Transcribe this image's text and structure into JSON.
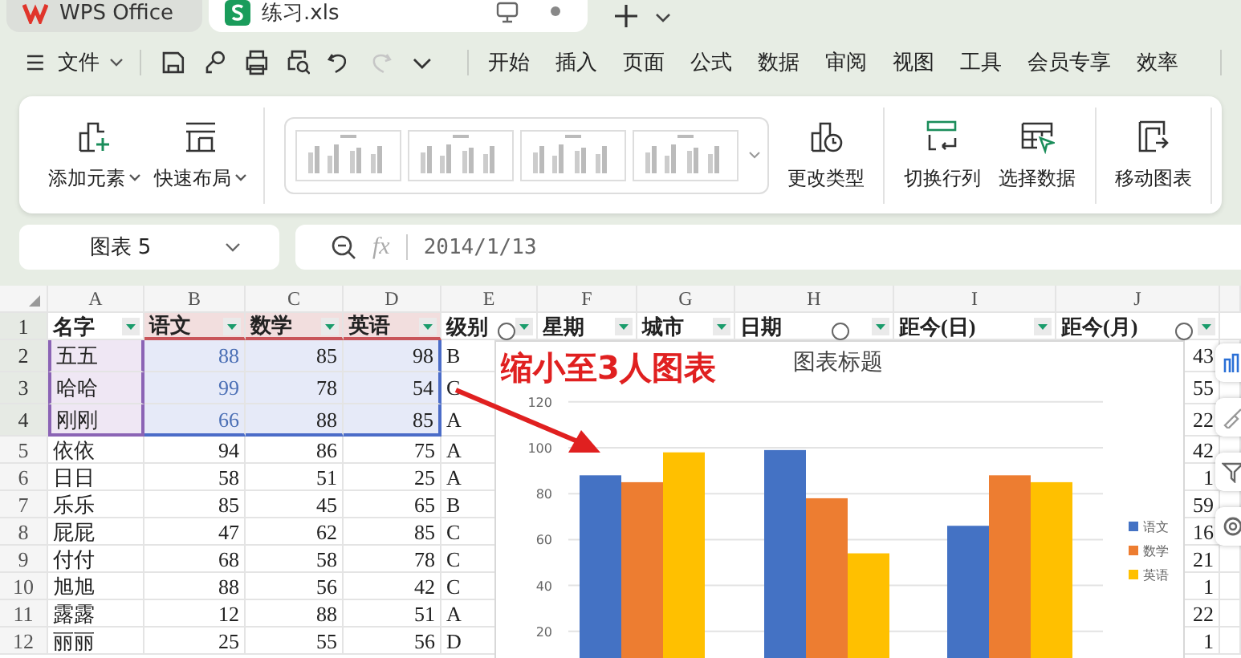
{
  "tabs": [
    {
      "label": "WPS Office",
      "kind": "home",
      "selected": false
    },
    {
      "label": "练习.xls",
      "kind": "sheet",
      "selected": true
    }
  ],
  "menu": {
    "file": "文件",
    "quick_access": [
      {
        "kind": "save",
        "disabled": false
      },
      {
        "kind": "share",
        "disabled": false
      },
      {
        "kind": "print",
        "disabled": false
      },
      {
        "kind": "preview",
        "disabled": false
      },
      {
        "kind": "undo",
        "disabled": false
      },
      {
        "kind": "redo",
        "disabled": true
      },
      {
        "kind": "more",
        "disabled": false
      }
    ],
    "items": [
      "开始",
      "插入",
      "页面",
      "公式",
      "数据",
      "审阅",
      "视图",
      "工具",
      "会员专享",
      "效率"
    ]
  },
  "ribbon": {
    "left": [
      {
        "label": "添加元素",
        "kind": "add"
      },
      {
        "label": "快速布局",
        "kind": "layout"
      }
    ],
    "chart_styles": [
      {
        "kind": "picture"
      },
      {
        "kind": "picture"
      },
      {
        "kind": "picture"
      },
      {
        "kind": "picture"
      }
    ],
    "groups": [
      [
        {
          "label": "更改类型",
          "kind": "change"
        }
      ],
      [
        {
          "label": "切换行列",
          "kind": "switch"
        },
        {
          "label": "选择数据",
          "kind": "select"
        }
      ],
      [
        {
          "label": "移动图表",
          "kind": "move"
        }
      ]
    ]
  },
  "formula_bar": {
    "name_box": "图表 5",
    "fx": "fx",
    "value": "2014/1/13"
  },
  "sheet": {
    "filter": true,
    "columns": [
      "A",
      "B",
      "C",
      "D",
      "E",
      "F",
      "G",
      "H",
      "I",
      "J"
    ],
    "rows": [
      {
        "number": "1",
        "selected": true,
        "cells": {
          "A": "名字",
          "B": "语文",
          "C": "数学",
          "D": "英语",
          "E": "级别",
          "F": "星期",
          "G": "城市",
          "H": "日期",
          "I": "距今(日)",
          "J": "距今(月)"
        }
      },
      {
        "number": "2",
        "selected": true,
        "cells": {
          "A": "五五",
          "B": "88",
          "C": "85",
          "D": "98",
          "E": "B",
          "J": "43"
        }
      },
      {
        "number": "3",
        "selected": true,
        "cells": {
          "A": "哈哈",
          "B": "99",
          "C": "78",
          "D": "54",
          "E": "C",
          "J": "55"
        }
      },
      {
        "number": "4",
        "selected": true,
        "cells": {
          "A": "刚刚",
          "B": "66",
          "C": "88",
          "D": "85",
          "E": "A",
          "J": "22"
        }
      },
      {
        "number": "5",
        "selected": false,
        "cells": {
          "A": "依依",
          "B": "94",
          "C": "86",
          "D": "75",
          "E": "A",
          "J": "42"
        }
      },
      {
        "number": "6",
        "selected": false,
        "cells": {
          "A": "日日",
          "B": "58",
          "C": "51",
          "D": "25",
          "E": "A",
          "J": "1"
        }
      },
      {
        "number": "7",
        "selected": false,
        "cells": {
          "A": "乐乐",
          "B": "85",
          "C": "45",
          "D": "65",
          "E": "B",
          "J": "59"
        }
      },
      {
        "number": "8",
        "selected": false,
        "cells": {
          "A": "屁屁",
          "B": "47",
          "C": "62",
          "D": "85",
          "E": "C",
          "J": "16"
        }
      },
      {
        "number": "9",
        "selected": false,
        "cells": {
          "A": "付付",
          "B": "68",
          "C": "58",
          "D": "78",
          "E": "C",
          "J": "21"
        }
      },
      {
        "number": "10",
        "selected": false,
        "cells": {
          "A": "旭旭",
          "B": "88",
          "C": "56",
          "D": "42",
          "E": "C",
          "J": "1"
        }
      },
      {
        "number": "11",
        "selected": false,
        "cells": {
          "A": "露露",
          "B": "12",
          "C": "88",
          "D": "51",
          "E": "A",
          "J": "22"
        }
      },
      {
        "number": "12",
        "selected": false,
        "cells": {
          "A": "丽丽",
          "B": "25",
          "C": "55",
          "D": "56",
          "E": "D",
          "J": "1"
        }
      }
    ]
  },
  "chart": {
    "selected": true,
    "annotation": "缩小至3人图表",
    "chart_data": {
      "type": "bar",
      "title": "图表标题",
      "grid": true,
      "legend": true,
      "ylim": [
        0,
        120
      ],
      "yticks": [
        20,
        40,
        60,
        80,
        100,
        120
      ],
      "series": [
        {
          "name": "语文",
          "color": "#4472c4",
          "values": [
            88,
            99,
            66
          ]
        },
        {
          "name": "数学",
          "color": "#ed7d31",
          "values": [
            85,
            78,
            88
          ]
        },
        {
          "name": "英语",
          "color": "#ffc000",
          "values": [
            98,
            54,
            85
          ]
        }
      ]
    }
  },
  "side_tools": [
    {
      "kind": "chart"
    },
    {
      "kind": "brush"
    },
    {
      "kind": "filter"
    },
    {
      "kind": "gear"
    }
  ]
}
